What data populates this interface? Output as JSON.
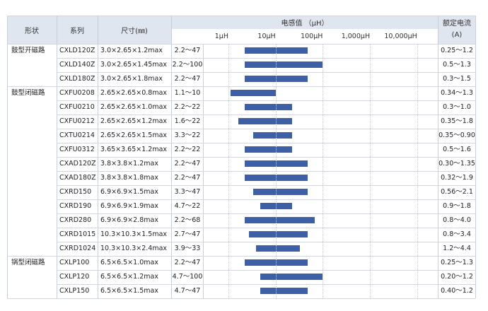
{
  "headers": {
    "shape": "形状",
    "series": "系列",
    "size": "尺寸(㎜)",
    "inductance": "电感值 （μH）",
    "current_line1": "额定电流",
    "current_line2": "(A)",
    "scale": [
      "1μH",
      "10μH",
      "100μH",
      "1,000μH",
      "10,000μH"
    ]
  },
  "groups": [
    {
      "label": "鼓型开磁路",
      "start": 0
    },
    {
      "label": "鼓型闭磁路",
      "start": 3
    },
    {
      "label": "锅型闭磁路",
      "start": 15
    }
  ],
  "rows": [
    {
      "series": "CXLD120Z",
      "size": "3.0×2.65×1.2max",
      "range": "2.2～47",
      "min": 2.2,
      "max": 47,
      "current": "0.25～1.2"
    },
    {
      "series": "CXLD140Z",
      "size": "3.0×2.65×1.45max",
      "range": "2.2～100",
      "min": 2.2,
      "max": 100,
      "current": "0.5～1.3"
    },
    {
      "series": "CXLD180Z",
      "size": "3.0×2.65×1.8max",
      "range": "2.2～47",
      "min": 2.2,
      "max": 47,
      "current": "0.3～1.5"
    },
    {
      "series": "CXFU0208",
      "size": "2.65×2.65×0.8max",
      "range": "1.1～10",
      "min": 1.1,
      "max": 10,
      "current": "0.34～1.3"
    },
    {
      "series": "CXFU0210",
      "size": "2.65×2.65×1.0max",
      "range": "2.2～22",
      "min": 2.2,
      "max": 22,
      "current": "0.3～1.0"
    },
    {
      "series": "CXFU0212",
      "size": "2.65×2.65×1.2max",
      "range": "1.6～22",
      "min": 1.6,
      "max": 22,
      "current": "0.35～1.8"
    },
    {
      "series": "CXTU0214",
      "size": "2.65×2.65×1.5max",
      "range": "3.3～22",
      "min": 3.3,
      "max": 22,
      "current": "0.35～0.90"
    },
    {
      "series": "CXFU0312",
      "size": "3.65×3.65×1.2max",
      "range": "2.2～22",
      "min": 2.2,
      "max": 22,
      "current": "0.5～1.6"
    },
    {
      "series": "CXAD120Z",
      "size": "3.8×3.8×1.2max",
      "range": "2.2～47",
      "min": 2.2,
      "max": 47,
      "current": "0.30～1.35"
    },
    {
      "series": "CXAD180Z",
      "size": "3.8×3.8×1.8max",
      "range": "2.2～47",
      "min": 2.2,
      "max": 47,
      "current": "0.32～1.9"
    },
    {
      "series": "CXRD150",
      "size": "6.9×6.9×1.5max",
      "range": "3.3～47",
      "min": 3.3,
      "max": 47,
      "current": "0.56～2.1"
    },
    {
      "series": "CXRD190",
      "size": "6.9×6.9×1.9max",
      "range": "4.7～22",
      "min": 4.7,
      "max": 22,
      "current": "0.9～1.8"
    },
    {
      "series": "CXRD280",
      "size": "6.9×6.9×2.8max",
      "range": "2.2～68",
      "min": 2.2,
      "max": 68,
      "current": "0.8～4.0"
    },
    {
      "series": "CXRD1015",
      "size": "10.3×10.3×1.5max",
      "range": "2.7～47",
      "min": 2.7,
      "max": 47,
      "current": "0.8～3.4"
    },
    {
      "series": "CXRD1024",
      "size": "10.3×10.3×2.4max",
      "range": "3.9～33",
      "min": 3.9,
      "max": 33,
      "current": "1.2～4.4"
    },
    {
      "series": "CXLP100",
      "size": "6.5×6.5×1.0max",
      "range": "2.2～47",
      "min": 2.2,
      "max": 47,
      "current": "0.25～1.3"
    },
    {
      "series": "CXLP120",
      "size": "6.5×6.5×1.2max",
      "range": "4.7～100",
      "min": 4.7,
      "max": 100,
      "current": "0.20～1.2"
    },
    {
      "series": "CXLP150",
      "size": "6.5×6.5×1.5max",
      "range": "4.7～47",
      "min": 4.7,
      "max": 47,
      "current": "0.40～1.2"
    }
  ],
  "colors": {
    "header_bg": "#dfe6ef",
    "bar": "#3d5fa6",
    "border": "#c9cfd8"
  }
}
